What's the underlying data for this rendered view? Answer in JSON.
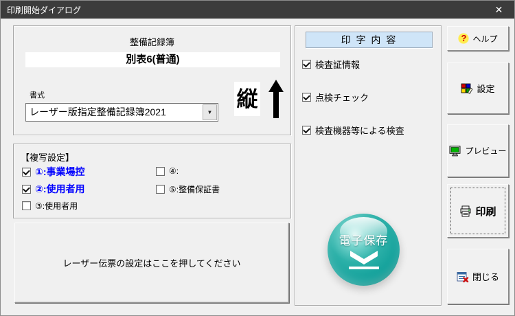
{
  "window": {
    "title": "印刷開始ダイアログ",
    "close_glyph": "✕"
  },
  "report": {
    "title": "整備記録簿",
    "form_name": "別表6(普通)",
    "format_label": "書式",
    "format_value": "レーザー版指定整備記録簿2021",
    "dropdown_glyph": "▼",
    "orientation_char": "縦",
    "orientation_arrow": "↑"
  },
  "copy": {
    "title": "【複写設定】",
    "items": [
      {
        "label": "①:事業場控",
        "checked": true,
        "emphasis": true
      },
      {
        "label": "②:使用者用",
        "checked": true,
        "emphasis": true
      },
      {
        "label": "③:使用者用",
        "checked": false,
        "emphasis": false
      },
      {
        "label": "④:",
        "checked": false,
        "emphasis": false
      },
      {
        "label": "⑤:整備保証書",
        "checked": false,
        "emphasis": false
      }
    ]
  },
  "laser": {
    "label": "レーザー伝票の設定はここを押してください"
  },
  "content": {
    "title": "印 字 内 容",
    "items": [
      {
        "label": "検査証情報",
        "checked": true
      },
      {
        "label": "点検チェック",
        "checked": true
      },
      {
        "label": "検査機器等による検査",
        "checked": true
      }
    ]
  },
  "esave": {
    "label": "電子保存"
  },
  "buttons": [
    {
      "label": "ヘルプ"
    },
    {
      "label": "設定"
    },
    {
      "label": "プレビュー"
    },
    {
      "label": "印刷",
      "focused": true
    },
    {
      "label": "閉じる"
    }
  ],
  "colors": {
    "accent_blue": "#0000ff",
    "header_blue": "#cfe5f8",
    "orb_teal": "#12a09a",
    "titlebar": "#3c3c3c"
  }
}
